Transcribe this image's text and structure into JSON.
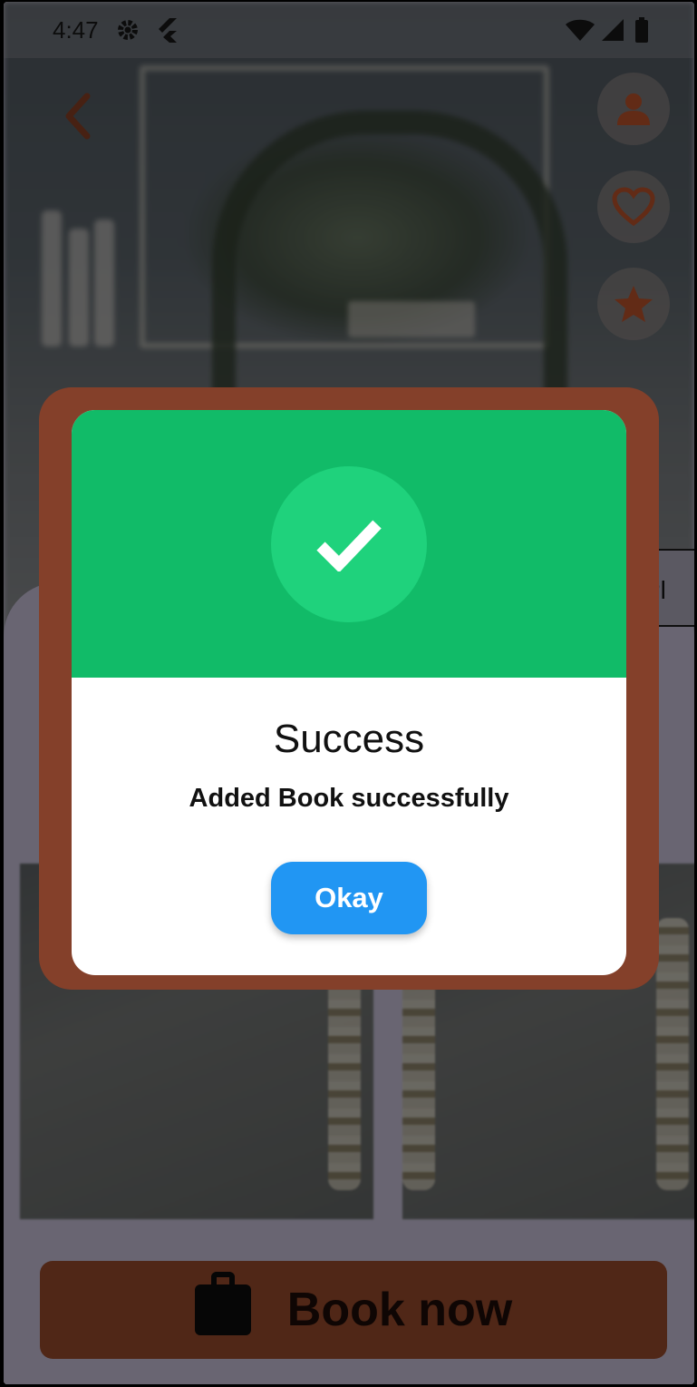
{
  "status_bar": {
    "time": "4:47",
    "icons": [
      "gear-icon",
      "flutter-icon",
      "wifi-icon",
      "signal-icon",
      "battery-icon"
    ]
  },
  "page": {
    "side_actions": [
      "person-icon",
      "heart-icon",
      "star-icon"
    ],
    "partial_tab_label": "Pl",
    "book_button_label": "Book now"
  },
  "dialog": {
    "icon": "check-icon",
    "title": "Success",
    "message": "Added Book successfully",
    "button_label": "Okay"
  },
  "colors": {
    "dialog_header": "#11bb68",
    "check_circle": "#1fd27c",
    "button": "#2196f3",
    "dialog_frame": "#84402a",
    "accent": "#e2643a"
  }
}
